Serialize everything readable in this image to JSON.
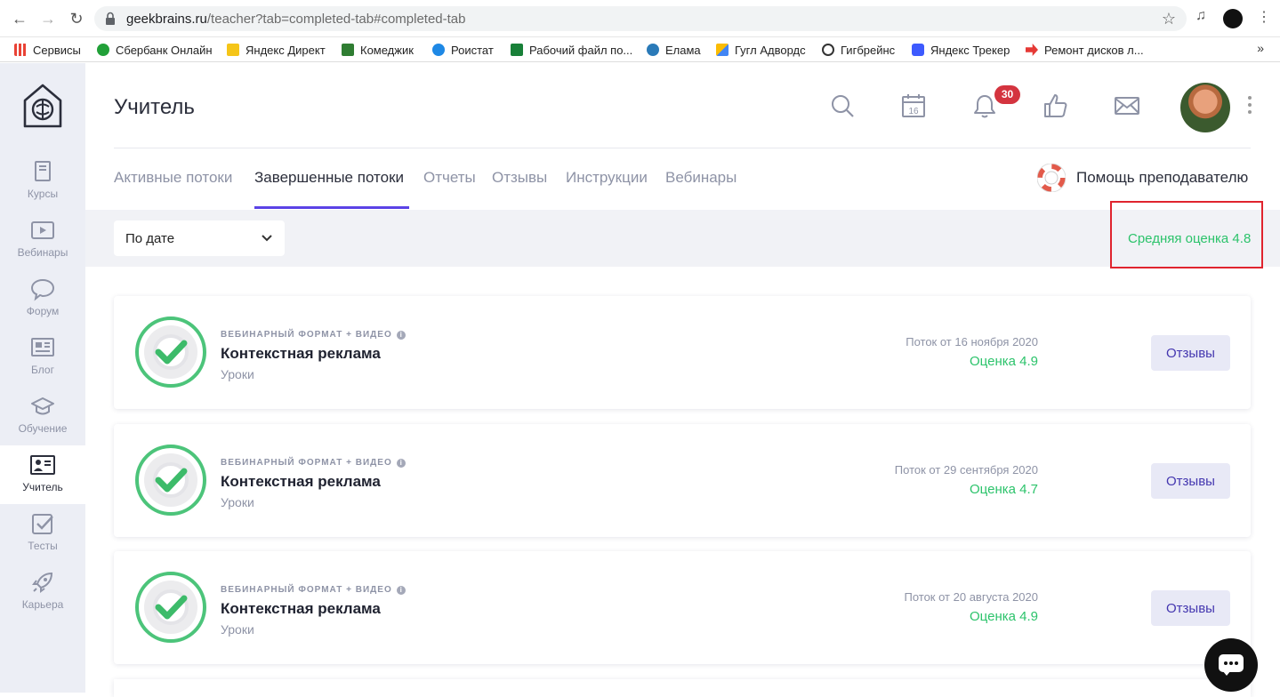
{
  "browser": {
    "url_host": "geekbrains.ru",
    "url_path": "/teacher?tab=completed-tab#completed-tab",
    "bookmarks": [
      {
        "label": "Сервисы",
        "color": "#e94235"
      },
      {
        "label": "Сбербанк Онлайн",
        "color": "#21a038"
      },
      {
        "label": "Яндекс Директ",
        "color": "#f5c518"
      },
      {
        "label": "Комеджик",
        "color": "#2f7d32"
      },
      {
        "label": "Роистат",
        "color": "#1e88e5"
      },
      {
        "label": "Рабочий файл по...",
        "color": "#188038"
      },
      {
        "label": "Елама",
        "color": "#2a7ab8"
      },
      {
        "label": "Гугл Адвордс",
        "color": "#fbbc04"
      },
      {
        "label": "Гигбрейнс",
        "color": "#333333"
      },
      {
        "label": "Яндекс Трекер",
        "color": "#3d5afe"
      },
      {
        "label": "Ремонт дисков л...",
        "color": "#e53935"
      }
    ],
    "more": "»"
  },
  "sidebar": {
    "items": [
      {
        "label": "Курсы",
        "icon": "book-icon"
      },
      {
        "label": "Вебинары",
        "icon": "play-icon"
      },
      {
        "label": "Форум",
        "icon": "chat-bubble-icon"
      },
      {
        "label": "Блог",
        "icon": "newspaper-icon"
      },
      {
        "label": "Обучение",
        "icon": "graduation-cap-icon"
      },
      {
        "label": "Учитель",
        "icon": "teacher-board-icon"
      },
      {
        "label": "Тесты",
        "icon": "checkbox-icon"
      },
      {
        "label": "Карьера",
        "icon": "rocket-icon"
      }
    ],
    "active_index": 5
  },
  "header": {
    "title": "Учитель",
    "calendar_day": "16",
    "notifications_count": "30"
  },
  "tabs": [
    {
      "label": "Активные потоки"
    },
    {
      "label": "Завершенные потоки"
    },
    {
      "label": "Отчеты"
    },
    {
      "label": "Отзывы"
    },
    {
      "label": "Инструкции"
    },
    {
      "label": "Вебинары"
    }
  ],
  "active_tab": 1,
  "help_label": "Помощь преподавателю",
  "filter": {
    "selected": "По дате"
  },
  "average_rating": "Средняя оценка 4.8",
  "courses": [
    {
      "format": "ВЕБИНАРНЫЙ ФОРМАТ + ВИДЕО",
      "info": "i",
      "name": "Контекстная реклама",
      "sub": "Уроки",
      "date": "Поток от 16 ноября 2020",
      "grade": "Оценка 4.9",
      "button": "Отзывы"
    },
    {
      "format": "ВЕБИНАРНЫЙ ФОРМАТ + ВИДЕО",
      "info": "i",
      "name": "Контекстная реклама",
      "sub": "Уроки",
      "date": "Поток от 29 сентября 2020",
      "grade": "Оценка 4.7",
      "button": "Отзывы"
    },
    {
      "format": "ВЕБИНАРНЫЙ ФОРМАТ + ВИДЕО",
      "info": "i",
      "name": "Контекстная реклама",
      "sub": "Уроки",
      "date": "Поток от 20 августа 2020",
      "grade": "Оценка 4.9",
      "button": "Отзывы"
    }
  ],
  "colors": {
    "accent": "#5b43e6",
    "success": "#2cc36b",
    "badge": "#d4343f",
    "highlight": "#e0242e"
  }
}
